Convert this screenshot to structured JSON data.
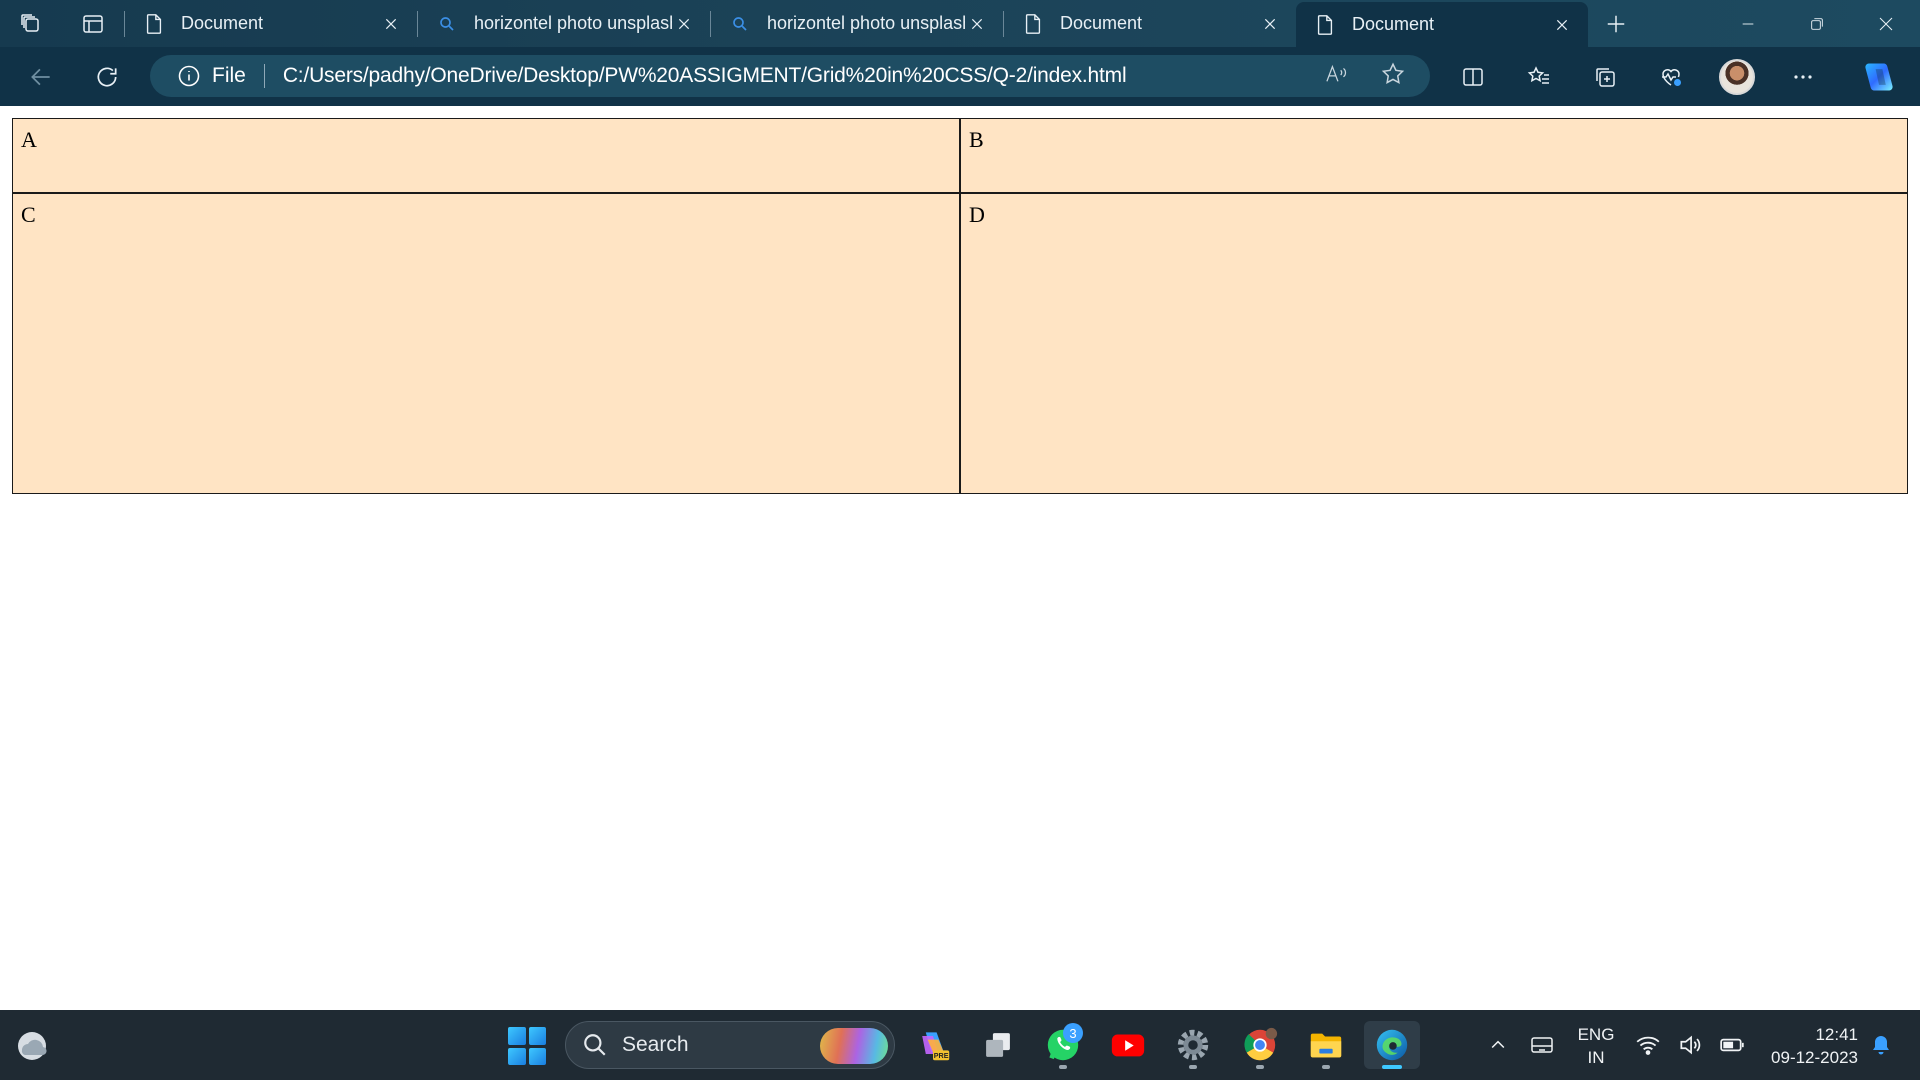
{
  "browser": {
    "tabs": [
      {
        "title": "Document",
        "icon": "page-icon",
        "active": false
      },
      {
        "title": "horizontel photo unsplash",
        "icon": "search-icon",
        "active": false
      },
      {
        "title": "horizontel photo unsplash",
        "icon": "search-icon",
        "active": false
      },
      {
        "title": "Document",
        "icon": "page-icon",
        "active": false
      },
      {
        "title": "Document",
        "icon": "page-icon",
        "active": true
      }
    ],
    "address": {
      "scheme_label": "File",
      "url": "C:/Users/padhy/OneDrive/Desktop/PW%20ASSIGMENT/Grid%20in%20CSS/Q-2/index.html"
    },
    "colors": {
      "chrome_dark": "#103247",
      "chrome_tabbar": "#1b4257"
    }
  },
  "page": {
    "cells": [
      "A",
      "B",
      "C",
      "D"
    ],
    "cell_background": "#ffe4c4"
  },
  "taskbar": {
    "search_label": "Search",
    "whatsapp_badge": "3",
    "language": {
      "line1": "ENG",
      "line2": "IN"
    },
    "clock": {
      "time": "12:41",
      "date": "09-12-2023"
    },
    "apps": [
      "copilot-pre-icon",
      "task-view-icon",
      "whatsapp-icon",
      "youtube-icon",
      "settings-icon",
      "chrome-icon",
      "file-explorer-icon",
      "edge-icon"
    ]
  }
}
